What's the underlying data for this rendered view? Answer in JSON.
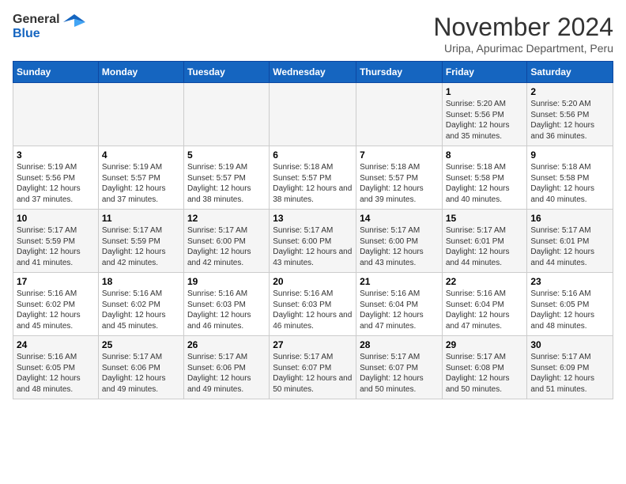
{
  "header": {
    "logo_general": "General",
    "logo_blue": "Blue",
    "month_title": "November 2024",
    "subtitle": "Uripa, Apurimac Department, Peru"
  },
  "weekdays": [
    "Sunday",
    "Monday",
    "Tuesday",
    "Wednesday",
    "Thursday",
    "Friday",
    "Saturday"
  ],
  "weeks": [
    [
      {
        "day": "",
        "info": ""
      },
      {
        "day": "",
        "info": ""
      },
      {
        "day": "",
        "info": ""
      },
      {
        "day": "",
        "info": ""
      },
      {
        "day": "",
        "info": ""
      },
      {
        "day": "1",
        "info": "Sunrise: 5:20 AM\nSunset: 5:56 PM\nDaylight: 12 hours\nand 35 minutes."
      },
      {
        "day": "2",
        "info": "Sunrise: 5:20 AM\nSunset: 5:56 PM\nDaylight: 12 hours\nand 36 minutes."
      }
    ],
    [
      {
        "day": "3",
        "info": "Sunrise: 5:19 AM\nSunset: 5:56 PM\nDaylight: 12 hours\nand 37 minutes."
      },
      {
        "day": "4",
        "info": "Sunrise: 5:19 AM\nSunset: 5:57 PM\nDaylight: 12 hours\nand 37 minutes."
      },
      {
        "day": "5",
        "info": "Sunrise: 5:19 AM\nSunset: 5:57 PM\nDaylight: 12 hours\nand 38 minutes."
      },
      {
        "day": "6",
        "info": "Sunrise: 5:18 AM\nSunset: 5:57 PM\nDaylight: 12 hours\nand 38 minutes."
      },
      {
        "day": "7",
        "info": "Sunrise: 5:18 AM\nSunset: 5:57 PM\nDaylight: 12 hours\nand 39 minutes."
      },
      {
        "day": "8",
        "info": "Sunrise: 5:18 AM\nSunset: 5:58 PM\nDaylight: 12 hours\nand 40 minutes."
      },
      {
        "day": "9",
        "info": "Sunrise: 5:18 AM\nSunset: 5:58 PM\nDaylight: 12 hours\nand 40 minutes."
      }
    ],
    [
      {
        "day": "10",
        "info": "Sunrise: 5:17 AM\nSunset: 5:59 PM\nDaylight: 12 hours\nand 41 minutes."
      },
      {
        "day": "11",
        "info": "Sunrise: 5:17 AM\nSunset: 5:59 PM\nDaylight: 12 hours\nand 42 minutes."
      },
      {
        "day": "12",
        "info": "Sunrise: 5:17 AM\nSunset: 6:00 PM\nDaylight: 12 hours\nand 42 minutes."
      },
      {
        "day": "13",
        "info": "Sunrise: 5:17 AM\nSunset: 6:00 PM\nDaylight: 12 hours\nand 43 minutes."
      },
      {
        "day": "14",
        "info": "Sunrise: 5:17 AM\nSunset: 6:00 PM\nDaylight: 12 hours\nand 43 minutes."
      },
      {
        "day": "15",
        "info": "Sunrise: 5:17 AM\nSunset: 6:01 PM\nDaylight: 12 hours\nand 44 minutes."
      },
      {
        "day": "16",
        "info": "Sunrise: 5:17 AM\nSunset: 6:01 PM\nDaylight: 12 hours\nand 44 minutes."
      }
    ],
    [
      {
        "day": "17",
        "info": "Sunrise: 5:16 AM\nSunset: 6:02 PM\nDaylight: 12 hours\nand 45 minutes."
      },
      {
        "day": "18",
        "info": "Sunrise: 5:16 AM\nSunset: 6:02 PM\nDaylight: 12 hours\nand 45 minutes."
      },
      {
        "day": "19",
        "info": "Sunrise: 5:16 AM\nSunset: 6:03 PM\nDaylight: 12 hours\nand 46 minutes."
      },
      {
        "day": "20",
        "info": "Sunrise: 5:16 AM\nSunset: 6:03 PM\nDaylight: 12 hours\nand 46 minutes."
      },
      {
        "day": "21",
        "info": "Sunrise: 5:16 AM\nSunset: 6:04 PM\nDaylight: 12 hours\nand 47 minutes."
      },
      {
        "day": "22",
        "info": "Sunrise: 5:16 AM\nSunset: 6:04 PM\nDaylight: 12 hours\nand 47 minutes."
      },
      {
        "day": "23",
        "info": "Sunrise: 5:16 AM\nSunset: 6:05 PM\nDaylight: 12 hours\nand 48 minutes."
      }
    ],
    [
      {
        "day": "24",
        "info": "Sunrise: 5:16 AM\nSunset: 6:05 PM\nDaylight: 12 hours\nand 48 minutes."
      },
      {
        "day": "25",
        "info": "Sunrise: 5:17 AM\nSunset: 6:06 PM\nDaylight: 12 hours\nand 49 minutes."
      },
      {
        "day": "26",
        "info": "Sunrise: 5:17 AM\nSunset: 6:06 PM\nDaylight: 12 hours\nand 49 minutes."
      },
      {
        "day": "27",
        "info": "Sunrise: 5:17 AM\nSunset: 6:07 PM\nDaylight: 12 hours\nand 50 minutes."
      },
      {
        "day": "28",
        "info": "Sunrise: 5:17 AM\nSunset: 6:07 PM\nDaylight: 12 hours\nand 50 minutes."
      },
      {
        "day": "29",
        "info": "Sunrise: 5:17 AM\nSunset: 6:08 PM\nDaylight: 12 hours\nand 50 minutes."
      },
      {
        "day": "30",
        "info": "Sunrise: 5:17 AM\nSunset: 6:09 PM\nDaylight: 12 hours\nand 51 minutes."
      }
    ]
  ]
}
